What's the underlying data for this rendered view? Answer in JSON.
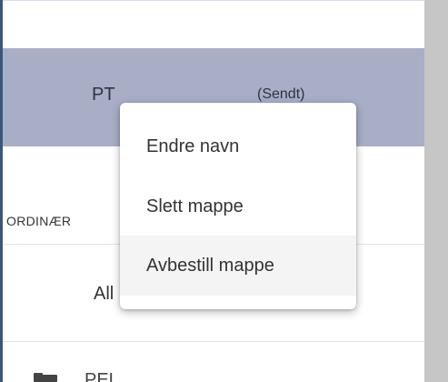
{
  "folder_row": {
    "name": "PT",
    "status": "(Sendt)"
  },
  "section": {
    "label": "ORDINÆR"
  },
  "all_row": {
    "label": "All"
  },
  "next_row": {
    "label": "PEL"
  },
  "context_menu": {
    "items": [
      {
        "label": "Endre navn"
      },
      {
        "label": "Slett mappe"
      },
      {
        "label": "Avbestill mappe",
        "hovered": true
      }
    ]
  },
  "colors": {
    "selected_row": "#a8aec6",
    "accent": "#3b5677",
    "menu_hover": "#f4f4f4"
  },
  "icons": {
    "folder": "folder-icon"
  }
}
